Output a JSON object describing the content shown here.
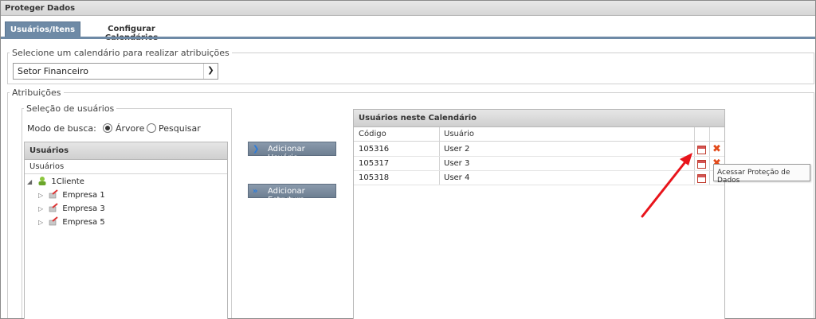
{
  "window": {
    "title": "Proteger Dados"
  },
  "tabs": [
    {
      "label": "Usuários/Itens",
      "active": true
    },
    {
      "label": "Configurar Calendários",
      "active": false
    }
  ],
  "calendar_section": {
    "legend": "Selecione um calendário para realizar atribuições",
    "selected": "Setor Financeiro"
  },
  "attributions": {
    "legend": "Atribuições",
    "user_selection": {
      "legend": "Seleção de usuários",
      "search_mode_label": "Modo de busca:",
      "option_tree": "Árvore",
      "option_search": "Pesquisar",
      "selected_mode": "Árvore"
    },
    "users_panel": {
      "title": "Usuários",
      "column": "Usuários",
      "tree": [
        {
          "label": "1Cliente",
          "icon": "client-icon",
          "expanded": true
        },
        {
          "label": "Empresa 1",
          "icon": "company-icon"
        },
        {
          "label": "Empresa 3",
          "icon": "company-icon"
        },
        {
          "label": "Empresa 5",
          "icon": "company-icon"
        }
      ]
    },
    "buttons": {
      "add_user": "Adicionar Usuário",
      "add_structure": "Adicionar Estrutura"
    },
    "calendar_users": {
      "title": "Usuários neste Calendário",
      "columns": [
        "Código",
        "Usuário"
      ],
      "rows": [
        {
          "code": "105316",
          "user": "User 2"
        },
        {
          "code": "105317",
          "user": "User 3"
        },
        {
          "code": "105318",
          "user": "User 4"
        }
      ]
    }
  },
  "tooltip": "Acessar Proteção de Dados",
  "colors": {
    "tab_active": "#6e8aa6",
    "annotation_arrow": "#e8141b",
    "delete_icon": "#e24a1b"
  }
}
